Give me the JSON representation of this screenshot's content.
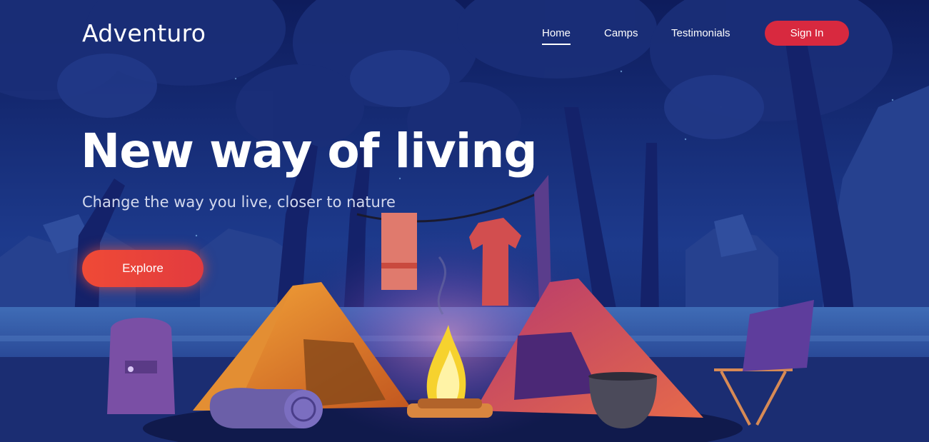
{
  "brand": {
    "name": "Adventuro"
  },
  "nav": {
    "items": [
      {
        "label": "Home",
        "active": true
      },
      {
        "label": "Camps",
        "active": false
      },
      {
        "label": "Testimonials",
        "active": false
      }
    ],
    "signin_label": "Sign In"
  },
  "hero": {
    "title": "New way of living",
    "subtitle": "Change the way you live, closer to nature",
    "cta_label": "Explore"
  },
  "colors": {
    "background": "#0f1f5e",
    "accent": "#d8293f",
    "cta": "#ef4a36",
    "text": "#ffffff"
  }
}
